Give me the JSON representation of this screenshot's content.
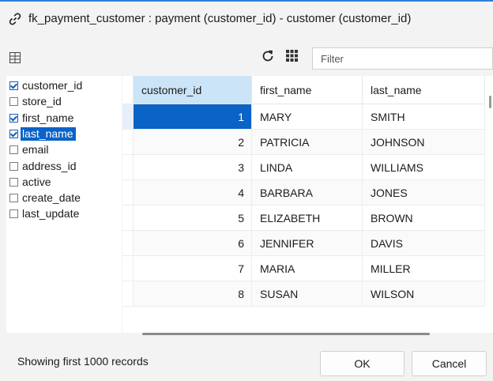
{
  "window": {
    "title": "fk_payment_customer : payment (customer_id) - customer (customer_id)"
  },
  "toolbar": {
    "filter_placeholder": "Filter"
  },
  "fields": [
    {
      "label": "customer_id",
      "checked": true,
      "selected": false
    },
    {
      "label": "store_id",
      "checked": false,
      "selected": false
    },
    {
      "label": "first_name",
      "checked": true,
      "selected": false
    },
    {
      "label": "last_name",
      "checked": true,
      "selected": true
    },
    {
      "label": "email",
      "checked": false,
      "selected": false
    },
    {
      "label": "address_id",
      "checked": false,
      "selected": false
    },
    {
      "label": "active",
      "checked": false,
      "selected": false
    },
    {
      "label": "create_date",
      "checked": false,
      "selected": false
    },
    {
      "label": "last_update",
      "checked": false,
      "selected": false
    }
  ],
  "table": {
    "columns": [
      "customer_id",
      "first_name",
      "last_name"
    ],
    "rows": [
      [
        "1",
        "MARY",
        "SMITH"
      ],
      [
        "2",
        "PATRICIA",
        "JOHNSON"
      ],
      [
        "3",
        "LINDA",
        "WILLIAMS"
      ],
      [
        "4",
        "BARBARA",
        "JONES"
      ],
      [
        "5",
        "ELIZABETH",
        "BROWN"
      ],
      [
        "6",
        "JENNIFER",
        "DAVIS"
      ],
      [
        "7",
        "MARIA",
        "MILLER"
      ],
      [
        "8",
        "SUSAN",
        "WILSON"
      ]
    ]
  },
  "status": {
    "text": "Showing first 1000 records"
  },
  "buttons": {
    "ok": "OK",
    "cancel": "Cancel"
  },
  "colors": {
    "accent": "#2f7fd8",
    "selection": "#0a63c7",
    "header_active": "#cce4f7"
  }
}
